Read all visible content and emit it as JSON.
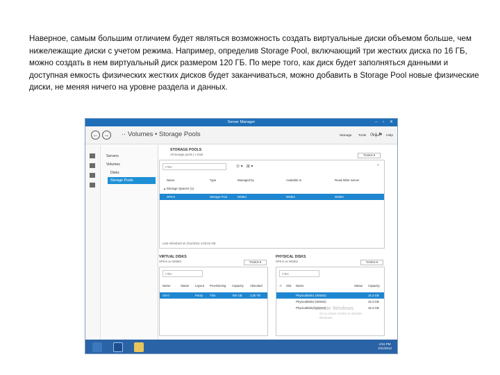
{
  "paragraph": "Наверное, самым большим отличием будет являться возможность создать виртуальные диски объемом больше, чем нижележащие диски с учетом режима. Например, определив Storage Pool, включающий три жестких диска по 16 ГБ, можно создать в нем виртуальный диск размером 120 ГБ. По мере того, как диск будет заполняться данными и доступная емкость физических жестких дисков будет заканчиваться, можно добавить в Storage Pool новые физические диски, не меняя ничего на уровне раздела и данных.",
  "window": {
    "title": "Server Manager"
  },
  "nav": {
    "back_glyph": "←",
    "fwd_glyph": "→",
    "breadcrumb": "·· Volumes • Storage Pools",
    "menus": [
      "Manage",
      "Tools",
      "View",
      "Help"
    ]
  },
  "sidebar": {
    "items": [
      "Servers",
      "Volumes",
      "Disks",
      "Storage Pools"
    ]
  },
  "storage_pools": {
    "title": "STORAGE POOLS",
    "subtitle": "All storage pools | 1 total",
    "tasks_label": "TASKS",
    "filter_placeholder": "Filter",
    "columns": [
      "Name",
      "Type",
      "Managed by",
      "Available to",
      "Read-Write Server"
    ],
    "group_label": "Storage Spaces (1)",
    "rows": [
      {
        "name": "SP0-6",
        "type": "Storage Pool",
        "managed_by": "WS8I2",
        "available_to": "WS8I2",
        "rw_server": "WS8I2"
      }
    ],
    "refreshed": "Last refreshed on 2/11/2013 4:29:32 AM"
  },
  "virtual_disks": {
    "title": "VIRTUAL DISKS",
    "subtitle": "SP0-6 on WS8I2",
    "tasks_label": "TASKS",
    "filter_placeholder": "Filter",
    "columns": [
      "Name",
      "Status",
      "Layout",
      "Provisioning",
      "Capacity",
      "Allocated"
    ],
    "rows": [
      {
        "name": "VD-0",
        "status": "",
        "layout": "Parity",
        "provisioning": "Thin",
        "capacity": "750 GB",
        "allocated": "2,00 TB"
      }
    ]
  },
  "physical_disks": {
    "title": "PHYSICAL DISKS",
    "subtitle": "SP0-6 on WS8I2",
    "tasks_label": "TASKS",
    "filter_placeholder": "Filter",
    "columns": [
      "Slot",
      "Name",
      "Status",
      "Capacity"
    ],
    "rows": [
      {
        "name": "PhysicalDisk1 (WS8I2)",
        "capacity": "15.3 GB"
      },
      {
        "name": "PhysicalDisk2 (WS8I2)",
        "capacity": "15.3 GB"
      },
      {
        "name": "PhysicalDisk3 (WS8I2)",
        "capacity": "15.3 GB"
      }
    ]
  },
  "watermark": {
    "title": "Activate Windows",
    "body": "Go to Action Center to activate Windows."
  },
  "taskbar": {
    "time": "4:51 PM",
    "date": "2/11/2013"
  },
  "colors": {
    "accent": "#1e86d0",
    "titlebar": "#1e6fb8",
    "taskbar": "#2a63a6"
  }
}
